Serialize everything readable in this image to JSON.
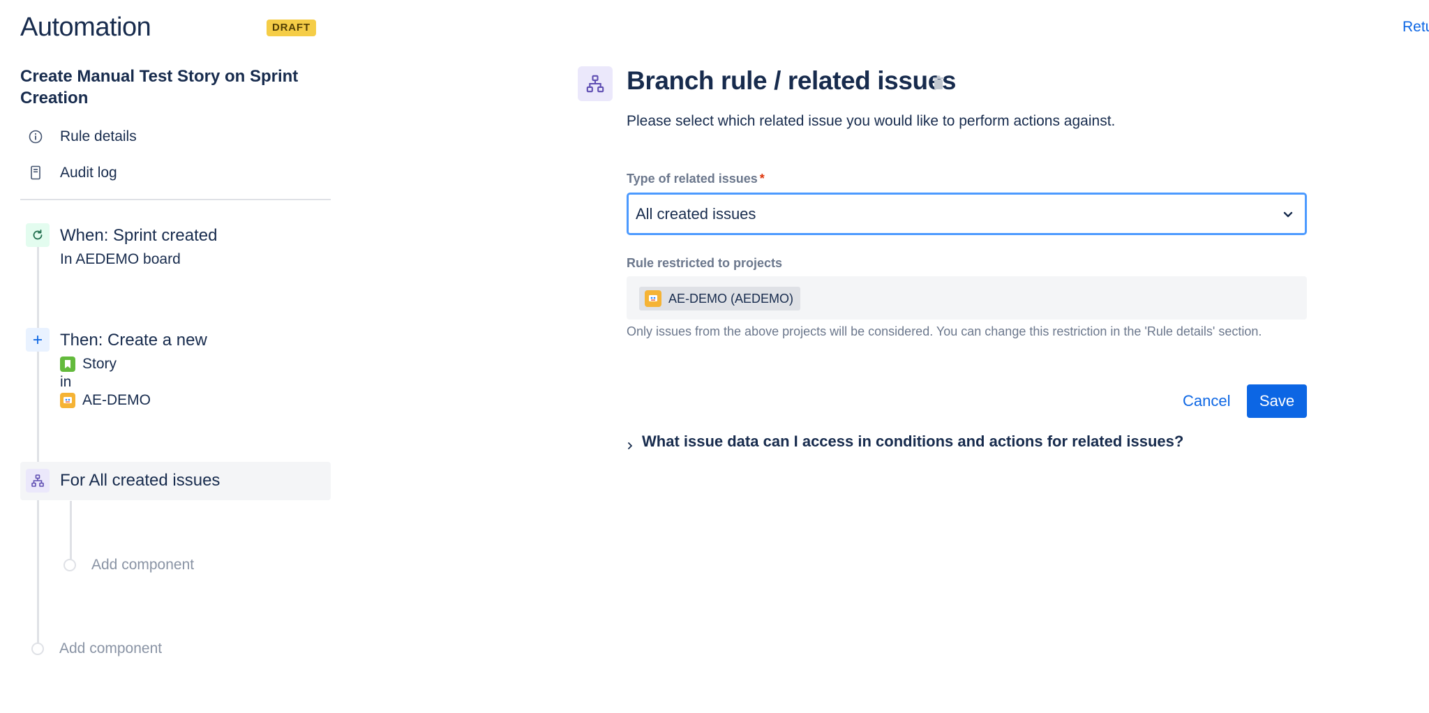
{
  "app": {
    "title": "Automation",
    "status_badge": "DRAFT",
    "return_link": "Retu"
  },
  "sidebar": {
    "rule_name": "Create Manual Test Story on Sprint Creation",
    "links": [
      {
        "label": "Rule details",
        "icon": "info-icon"
      },
      {
        "label": "Audit log",
        "icon": "audit-log-icon"
      }
    ],
    "trigger": {
      "title": "When: Sprint created",
      "subtitle": "In AEDEMO board",
      "icon": "refresh-icon"
    },
    "action": {
      "title": "Then: Create a new",
      "issue_type": "Story",
      "connector": "in",
      "project": "AE-DEMO",
      "icon": "plus-icon"
    },
    "branch": {
      "title": "For All created issues",
      "icon": "branch-icon"
    },
    "add_component_inner": "Add component",
    "add_component_outer": "Add component"
  },
  "panel": {
    "title": "Branch rule / related issues",
    "description": "Please select which related issue you would like to perform actions against.",
    "type_label": "Type of related issues",
    "required_mark": "*",
    "type_value": "All created issues",
    "projects_label": "Rule restricted to projects",
    "project_tag": "AE-DEMO (AEDEMO)",
    "help_text": "Only issues from the above projects will be considered. You can change this restriction in the 'Rule details' section.",
    "cancel_label": "Cancel",
    "save_label": "Save",
    "faq_label": "What issue data can I access in conditions and actions for related issues?"
  },
  "colors": {
    "accent": "#0c66e4",
    "draft_badge": "#f5cd47",
    "focus_border": "#4c9aff",
    "branch_bg": "#ebe8fb",
    "story_green": "#63ba3c",
    "project_avatar": "#f5b335"
  }
}
